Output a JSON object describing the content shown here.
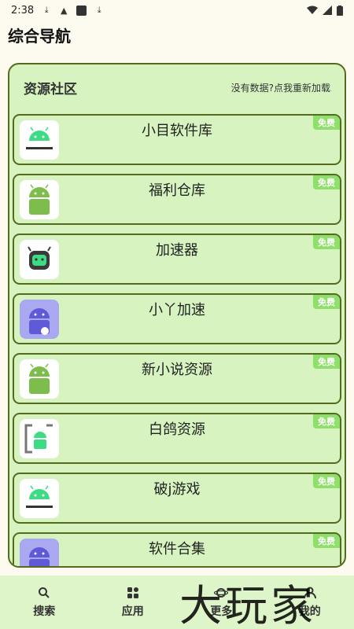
{
  "status": {
    "time": "2:38"
  },
  "header": {
    "title": "综合导航"
  },
  "panel": {
    "title": "资源社区",
    "reload": "没有数据?点我重新加载"
  },
  "apps": [
    {
      "name": "小目软件库",
      "badge": "免费",
      "icon": "android-wordmark-icon"
    },
    {
      "name": "福利仓库",
      "badge": "免费",
      "icon": "android-robot-icon"
    },
    {
      "name": "加速器",
      "badge": "免费",
      "icon": "robot-face-icon"
    },
    {
      "name": "小丫加速",
      "badge": "免费",
      "icon": "android-blue-icon"
    },
    {
      "name": "新小说资源",
      "badge": "免费",
      "icon": "android-robot-icon"
    },
    {
      "name": "白鸽资源",
      "badge": "免费",
      "icon": "android-frame-icon"
    },
    {
      "name": "破j游戏",
      "badge": "免费",
      "icon": "android-wordmark-icon"
    },
    {
      "name": "软件合集",
      "badge": "免费",
      "icon": "android-blue-icon"
    }
  ],
  "nav": [
    {
      "label": "搜索",
      "icon": "search-icon"
    },
    {
      "label": "应用",
      "icon": "apps-icon"
    },
    {
      "label": "更多",
      "icon": "planet-icon"
    },
    {
      "label": "我的",
      "icon": "user-icon"
    }
  ],
  "watermark": "大玩家",
  "colors": {
    "accent_border": "#556b1f",
    "card_bg": "#d6f3c0",
    "badge": "#8fe06a",
    "android_green": "#3ddc84"
  }
}
